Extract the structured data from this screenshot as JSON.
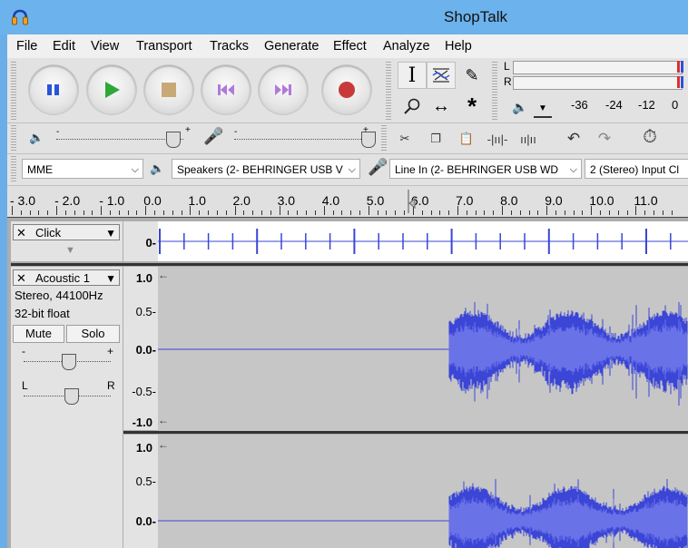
{
  "window": {
    "title": "ShopTalk"
  },
  "menu": [
    "File",
    "Edit",
    "View",
    "Transport",
    "Tracks",
    "Generate",
    "Effect",
    "Analyze",
    "Help"
  ],
  "meter": {
    "left_label": "L",
    "right_label": "R",
    "scale": [
      "-36",
      "-24",
      "-12",
      "0"
    ]
  },
  "devices": {
    "host": "MME",
    "playback": "Speakers (2- BEHRINGER USB V",
    "recording": "Line In (2- BEHRINGER USB WD",
    "channels": "2 (Stereo) Input Cl"
  },
  "ruler": {
    "ticks": [
      "- 3.0",
      "- 2.0",
      "- 1.0",
      "0.0",
      "1.0",
      "2.0",
      "3.0",
      "4.0",
      "5.0",
      "6.0",
      "7.0",
      "8.0",
      "9.0",
      "10.0",
      "11.0"
    ]
  },
  "tracks": {
    "click": {
      "name": "Click",
      "scale_zero": "0-"
    },
    "acoustic": {
      "name": "Acoustic 1",
      "format": "Stereo, 44100Hz",
      "bitdepth": "32-bit float",
      "mute": "Mute",
      "solo": "Solo",
      "gain_minus": "-",
      "gain_plus": "+",
      "pan_left": "L",
      "pan_right": "R",
      "scale_ch1": [
        "1.0",
        "0.5-",
        "0.0-",
        "-0.5-",
        "-1.0"
      ],
      "scale_ch2": [
        "1.0",
        "0.5-",
        "0.0-"
      ]
    }
  },
  "colors": {
    "waveform": "#3b45d6",
    "waveform_light": "#6a72e8",
    "titlebar": "#6cb2ec"
  }
}
